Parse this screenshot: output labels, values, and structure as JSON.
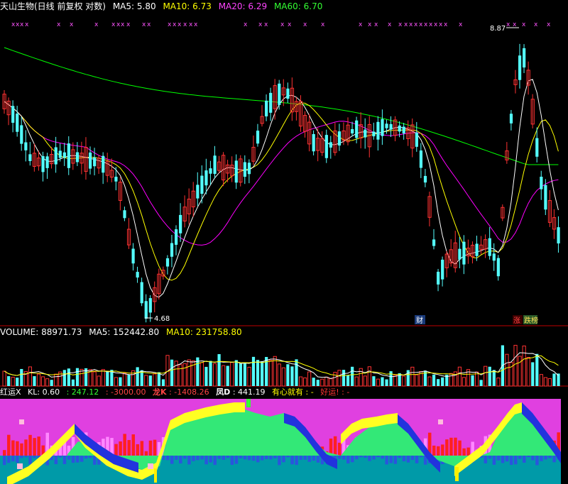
{
  "main_header": {
    "title": "天山生物(日线 前复权 对数)",
    "ma5_label": "MA5:",
    "ma5_value": "5.80",
    "ma10_label": "MA10:",
    "ma10_value": "6.73",
    "ma20_label": "MA20:",
    "ma20_value": "6.29",
    "ma60_label": "MA60:",
    "ma60_value": "6.70"
  },
  "price_panel": {
    "high_marker": "8.87",
    "low_marker": "4.68",
    "badge_cai": "财",
    "badge_zhang": "涨",
    "badge_zhang2": "跌榜",
    "x_marks": "x"
  },
  "volume_header": {
    "volume_label": "VOLUME:",
    "volume_value": "88971.73",
    "ma5_label": "MA5:",
    "ma5_value": "152442.80",
    "ma10_label": "MA10:",
    "ma10_value": "231758.80"
  },
  "indicator_header": {
    "name": "红运X",
    "kl_label": "KL:",
    "kl_value": "0.60",
    "v2": ": 247.12",
    "v3": ": -3000.00",
    "long_label": "龙K",
    "long_value": ": -1408.26",
    "feng_label": "凤D",
    "feng_value": ": 441.19",
    "youxin_label": "有心就有",
    "youxin_value": ": -",
    "haoyun_label": "好运!",
    "haoyun_value": ": -"
  },
  "colors": {
    "background": "#000000",
    "up": "#ff3232",
    "down": "#54ffff",
    "ma5": "#ffffff",
    "ma10": "#ffff00",
    "ma20": "#ff00ff",
    "ma60": "#00ff00",
    "grid": "#c00000",
    "indicator_bg": "#ff00ff"
  }
}
